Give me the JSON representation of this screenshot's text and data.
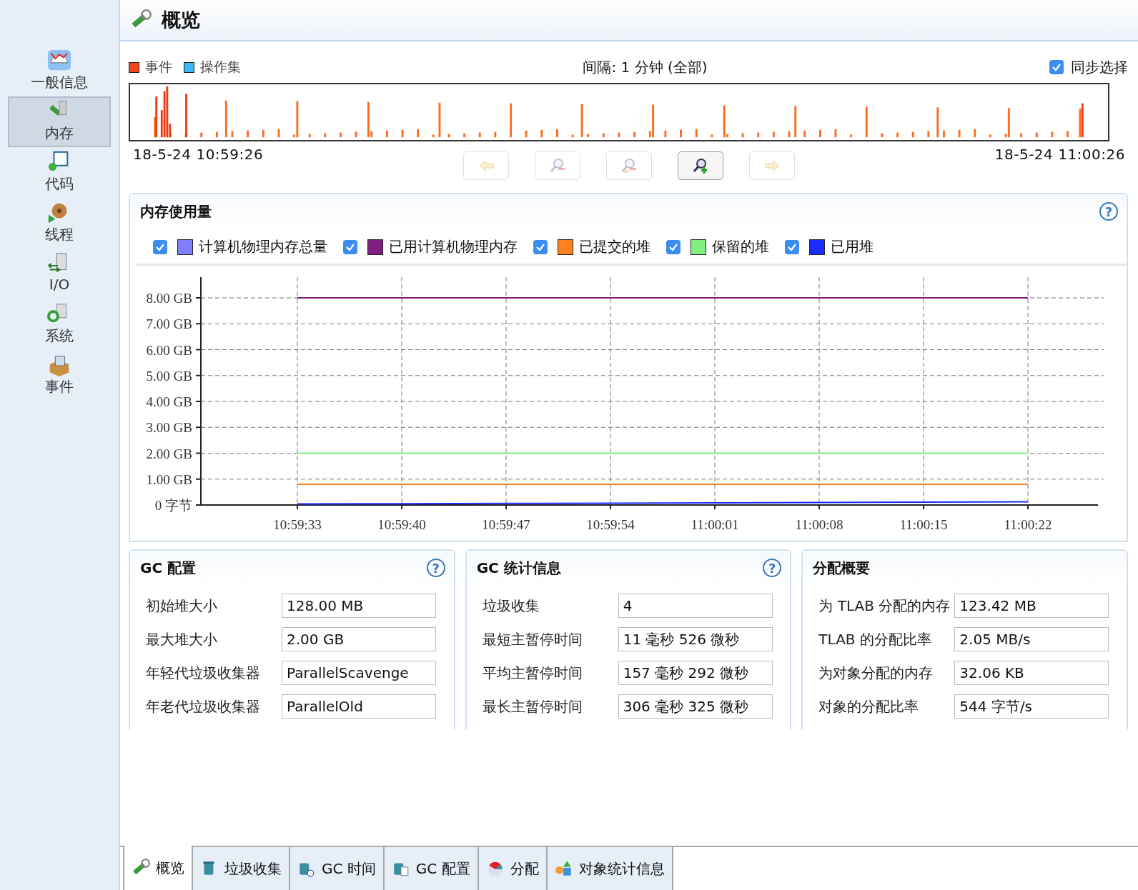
{
  "sidebar": {
    "items": [
      {
        "label": "一般信息",
        "selected": false
      },
      {
        "label": "内存",
        "selected": true
      },
      {
        "label": "代码",
        "selected": false
      },
      {
        "label": "线程",
        "selected": false
      },
      {
        "label": "I/O",
        "selected": false
      },
      {
        "label": "系统",
        "selected": false
      },
      {
        "label": "事件",
        "selected": false
      }
    ]
  },
  "page_title": "概览",
  "timeline": {
    "legend": [
      {
        "label": "事件",
        "color": "#f2461c"
      },
      {
        "label": "操作集",
        "color": "#3cb8f5"
      }
    ],
    "interval": "间隔: 1 分钟 (全部)",
    "sync_select": {
      "label": "同步选择",
      "checked": true
    },
    "start_time": "18-5-24 10:59:26",
    "end_time": "18-5-24 11:00:26",
    "toolbar": [
      {
        "disabled": true
      },
      {
        "disabled": true
      },
      {
        "disabled": true
      },
      {
        "disabled": false
      },
      {
        "disabled": true
      }
    ]
  },
  "memory_panel": {
    "title": "内存使用量",
    "help": "?",
    "legend": [
      {
        "checked": true
      },
      {
        "checked": true
      },
      {
        "checked": true
      },
      {
        "checked": true
      },
      {
        "checked": true
      }
    ],
    "chart_data": {
      "type": "line",
      "categories": [
        "10:59:33",
        "10:59:40",
        "10:59:47",
        "10:59:54",
        "11:00:01",
        "11:00:08",
        "11:00:15",
        "11:00:22"
      ],
      "ylim": [
        0,
        8.8
      ],
      "grid": true,
      "yticks": [
        {
          "value": 0,
          "label": "0 字节"
        },
        {
          "value": 1,
          "label": "1.00 GB"
        },
        {
          "value": 2,
          "label": "2.00 GB"
        },
        {
          "value": 3,
          "label": "3.00 GB"
        },
        {
          "value": 4,
          "label": "4.00 GB"
        },
        {
          "value": 5,
          "label": "5.00 GB"
        },
        {
          "value": 6,
          "label": "6.00 GB"
        },
        {
          "value": 7,
          "label": "7.00 GB"
        },
        {
          "value": 8,
          "label": "8.00 GB"
        }
      ],
      "series": [
        {
          "name": "计算机物理内存总量",
          "color": "#8080ff",
          "values": [
            null,
            null,
            null,
            null,
            null,
            null,
            null,
            null
          ]
        },
        {
          "name": "已用计算机物理内存",
          "color": "#7f1f7f",
          "values": [
            8,
            8,
            8,
            8,
            8,
            8,
            8,
            8
          ]
        },
        {
          "name": "已提交的堆",
          "color": "#ff8020",
          "values": [
            0.8,
            0.8,
            0.8,
            0.8,
            0.8,
            0.8,
            0.8,
            0.8
          ]
        },
        {
          "name": "保留的堆",
          "color": "#80f080",
          "values": [
            2,
            2,
            2,
            2,
            2,
            2,
            2,
            2
          ]
        },
        {
          "name": "已用堆",
          "color": "#1a2cff",
          "values": [
            0.04,
            0.05,
            0.06,
            0.07,
            0.08,
            0.1,
            0.11,
            0.12
          ]
        }
      ]
    }
  },
  "panels": [
    {
      "title": "GC 配置",
      "help": "?",
      "fields": [
        {
          "label": "初始堆大小",
          "value": "128.00 MB"
        },
        {
          "label": "最大堆大小",
          "value": "2.00 GB"
        },
        {
          "label": "年轻代垃圾收集器",
          "value": "ParallelScavenge"
        },
        {
          "label": "年老代垃圾收集器",
          "value": "ParallelOld"
        }
      ]
    },
    {
      "title": "GC 统计信息",
      "help": "?",
      "fields": [
        {
          "label": "垃圾收集",
          "value": "4"
        },
        {
          "label": "最短主暂停时间",
          "value": "11 毫秒 526 微秒"
        },
        {
          "label": "平均主暂停时间",
          "value": "157 毫秒 292 微秒"
        },
        {
          "label": "最长主暂停时间",
          "value": "306 毫秒 325 微秒"
        }
      ]
    },
    {
      "title": "分配概要",
      "fields": [
        {
          "label": "为 TLAB 分配的内存",
          "value": "123.42 MB"
        },
        {
          "label": "TLAB 的分配比率",
          "value": "2.05 MB/s"
        },
        {
          "label": "为对象分配的内存",
          "value": "32.06 KB"
        },
        {
          "label": "对象的分配比率",
          "value": "544 字节/s"
        }
      ]
    }
  ],
  "tabs": [
    {
      "label": "概览",
      "selected": true
    },
    {
      "label": "垃圾收集",
      "selected": false
    },
    {
      "label": "GC 时间",
      "selected": false
    },
    {
      "label": "GC 配置",
      "selected": false
    },
    {
      "label": "分配",
      "selected": false
    },
    {
      "label": "对象统计信息",
      "selected": false
    }
  ]
}
